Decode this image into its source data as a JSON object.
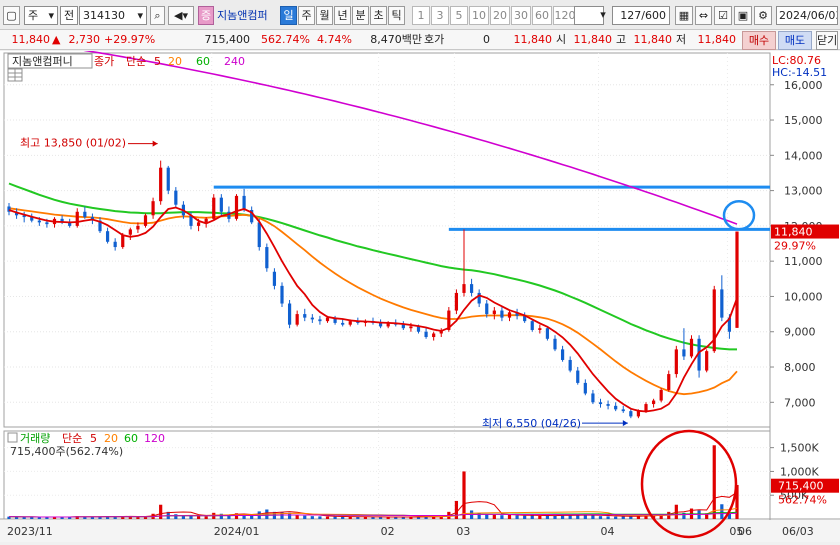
{
  "toolbar": {
    "menu_icon": "window-icon",
    "period_select": "주",
    "market_select": "전",
    "stock_code": "314130",
    "sound_icon": "speaker-icon",
    "badge_label": "증",
    "stock_name": "지놈앤컴퍼",
    "period_buttons": [
      "일",
      "주",
      "월",
      "년",
      "분",
      "초",
      "틱"
    ],
    "selected_period": "일",
    "interval_buttons": [
      "1",
      "3",
      "5",
      "10",
      "20",
      "30",
      "60",
      "120"
    ],
    "count": "127",
    "count_max": "/600",
    "date": "2024/06/03"
  },
  "infobar": {
    "price": "11,840",
    "arrow": "▲",
    "change": "2,730",
    "change_pct": "+29.97%",
    "volume": "715,400",
    "volume_pct": "562.74%",
    "turnover_pct": "4.74%",
    "amount": "8,470백만",
    "quote_label": "호가",
    "quote_value": "0",
    "quote_price": "11,840",
    "open_label": "시",
    "open_value": "11,840",
    "high_label": "고",
    "high_value": "11,840",
    "low_label": "저",
    "low_value": "11,840",
    "buy_label": "매수",
    "sell_label": "매도",
    "close_label": "닫기"
  },
  "chart_data": {
    "type": "candlestick",
    "legend": {
      "name": "지놈앤컴퍼니",
      "items": [
        {
          "label": "종가",
          "color": "#d00000"
        },
        {
          "label": "단순",
          "color": "#d00000"
        },
        {
          "label": "5",
          "color": "#d00000"
        },
        {
          "label": "20",
          "color": "#ff8000"
        },
        {
          "label": "60",
          "color": "#00b000"
        },
        {
          "label": "240",
          "color": "#cc00cc"
        }
      ],
      "lc": "LC:80.76",
      "hc": "HC:-14.51"
    },
    "y_ticks": [
      7000,
      8000,
      9000,
      10000,
      11000,
      12000,
      13000,
      14000,
      15000,
      16000
    ],
    "y_tick_labels": [
      "7,000",
      "8,000",
      "9,000",
      "10,000",
      "11,000",
      "12,000",
      "13,000",
      "14,000",
      "15,000",
      "16,000"
    ],
    "ylim": [
      6300,
      16900
    ],
    "current_price": 11840,
    "current_price_label": "11,840",
    "current_pct_label": "29.97%",
    "hlines": [
      13100,
      11900
    ],
    "max_annotation": "최고 13,850 (01/02)",
    "min_annotation": "최저 6,550 (04/26)",
    "x_tick_labels": [
      "2023/11",
      "2024/01",
      "02",
      "03",
      "04",
      "05",
      "06",
      "06/03"
    ],
    "candles": [
      [
        12550,
        12650,
        12300,
        12400
      ],
      [
        12400,
        12500,
        12200,
        12300
      ],
      [
        12300,
        12400,
        12100,
        12250
      ],
      [
        12250,
        12350,
        12100,
        12150
      ],
      [
        12150,
        12250,
        12000,
        12100
      ],
      [
        12100,
        12200,
        11950,
        12050
      ],
      [
        12050,
        12250,
        11950,
        12200
      ],
      [
        12200,
        12300,
        12050,
        12100
      ],
      [
        12100,
        12200,
        11950,
        12000
      ],
      [
        12000,
        12500,
        11950,
        12400
      ],
      [
        12400,
        12550,
        12200,
        12250
      ],
      [
        12250,
        12350,
        12050,
        12150
      ],
      [
        12150,
        12250,
        11800,
        11850
      ],
      [
        11850,
        11950,
        11500,
        11550
      ],
      [
        11550,
        11650,
        11300,
        11400
      ],
      [
        11400,
        11800,
        11350,
        11750
      ],
      [
        11750,
        11950,
        11600,
        11900
      ],
      [
        11900,
        12100,
        11800,
        12000
      ],
      [
        12000,
        12350,
        11950,
        12300
      ],
      [
        12300,
        12800,
        12200,
        12700
      ],
      [
        12700,
        13850,
        12600,
        13650
      ],
      [
        13650,
        13700,
        12900,
        13000
      ],
      [
        13000,
        13100,
        12500,
        12600
      ],
      [
        12600,
        12700,
        12200,
        12300
      ],
      [
        12300,
        12400,
        11900,
        12000
      ],
      [
        12000,
        12200,
        11850,
        12100
      ],
      [
        12100,
        12250,
        11950,
        12200
      ],
      [
        12200,
        12900,
        12150,
        12800
      ],
      [
        12800,
        12900,
        12300,
        12400
      ],
      [
        12400,
        12550,
        12100,
        12200
      ],
      [
        12200,
        12900,
        12150,
        12850
      ],
      [
        12850,
        13050,
        12400,
        12450
      ],
      [
        12450,
        12550,
        12050,
        12100
      ],
      [
        12100,
        12200,
        11300,
        11400
      ],
      [
        11400,
        11500,
        10700,
        10800
      ],
      [
        10700,
        10800,
        10200,
        10300
      ],
      [
        10300,
        10400,
        9700,
        9800
      ],
      [
        9800,
        9900,
        9100,
        9200
      ],
      [
        9200,
        9600,
        9150,
        9500
      ],
      [
        9500,
        9650,
        9300,
        9400
      ],
      [
        9400,
        9500,
        9250,
        9350
      ],
      [
        9350,
        9450,
        9200,
        9300
      ],
      [
        9300,
        9450,
        9250,
        9400
      ],
      [
        9400,
        9450,
        9200,
        9250
      ],
      [
        9250,
        9350,
        9150,
        9200
      ],
      [
        9200,
        9350,
        9150,
        9300
      ],
      [
        9300,
        9400,
        9200,
        9250
      ],
      [
        9250,
        9350,
        9150,
        9300
      ],
      [
        9300,
        9400,
        9200,
        9250
      ],
      [
        9250,
        9350,
        9100,
        9150
      ],
      [
        9150,
        9300,
        9100,
        9250
      ],
      [
        9250,
        9350,
        9150,
        9200
      ],
      [
        9200,
        9300,
        9050,
        9100
      ],
      [
        9100,
        9250,
        9000,
        9150
      ],
      [
        9150,
        9200,
        8950,
        9000
      ],
      [
        9000,
        9100,
        8800,
        8850
      ],
      [
        8850,
        9000,
        8750,
        8950
      ],
      [
        8950,
        9100,
        8850,
        9050
      ],
      [
        9050,
        9700,
        9000,
        9600
      ],
      [
        9600,
        10200,
        9500,
        10100
      ],
      [
        10100,
        11900,
        10000,
        10350
      ],
      [
        10350,
        10500,
        10000,
        10100
      ],
      [
        10100,
        10200,
        9700,
        9800
      ],
      [
        9800,
        9900,
        9400,
        9500
      ],
      [
        9500,
        9700,
        9350,
        9600
      ],
      [
        9600,
        9700,
        9300,
        9400
      ],
      [
        9400,
        9600,
        9300,
        9550
      ],
      [
        9550,
        9650,
        9350,
        9450
      ],
      [
        9450,
        9550,
        9250,
        9300
      ],
      [
        9300,
        9350,
        9000,
        9050
      ],
      [
        9050,
        9200,
        8950,
        9100
      ],
      [
        9100,
        9150,
        8750,
        8800
      ],
      [
        8800,
        8900,
        8450,
        8500
      ],
      [
        8500,
        8600,
        8150,
        8200
      ],
      [
        8200,
        8300,
        7850,
        7900
      ],
      [
        7900,
        8000,
        7500,
        7550
      ],
      [
        7550,
        7650,
        7200,
        7250
      ],
      [
        7250,
        7350,
        6950,
        7000
      ],
      [
        7000,
        7100,
        6850,
        6950
      ],
      [
        6950,
        7050,
        6800,
        6900
      ],
      [
        6900,
        7000,
        6750,
        6800
      ],
      [
        6800,
        6900,
        6700,
        6750
      ],
      [
        6750,
        6800,
        6550,
        6600
      ],
      [
        6600,
        6800,
        6550,
        6750
      ],
      [
        6750,
        7000,
        6700,
        6950
      ],
      [
        6950,
        7100,
        6850,
        7050
      ],
      [
        7050,
        7400,
        7000,
        7350
      ],
      [
        7350,
        7900,
        7300,
        7800
      ],
      [
        7800,
        8600,
        7700,
        8500
      ],
      [
        8500,
        9100,
        8200,
        8300
      ],
      [
        8300,
        8900,
        8250,
        8800
      ],
      [
        8800,
        8900,
        7700,
        7900
      ],
      [
        7900,
        8500,
        7850,
        8450
      ],
      [
        8450,
        10300,
        8400,
        10200
      ],
      [
        10200,
        10600,
        9300,
        9400
      ],
      [
        9400,
        9500,
        8800,
        9000
      ],
      [
        9110,
        11840,
        9110,
        11840
      ]
    ],
    "ma5": [
      12450,
      12380,
      12320,
      12260,
      12200,
      12150,
      12120,
      12110,
      12100,
      12110,
      12150,
      12180,
      12120,
      12020,
      11880,
      11740,
      11690,
      11720,
      11800,
      11980,
      12250,
      12480,
      12520,
      12440,
      12300,
      12140,
      12070,
      12160,
      12280,
      12330,
      12420,
      12480,
      12380,
      12120,
      11780,
      11400,
      11000,
      10640,
      10300,
      10060,
      9760,
      9560,
      9420,
      9380,
      9360,
      9320,
      9300,
      9290,
      9280,
      9260,
      9250,
      9240,
      9220,
      9190,
      9160,
      9120,
      9060,
      9020,
      9110,
      9310,
      9620,
      9880,
      10030,
      9960,
      9830,
      9720,
      9610,
      9540,
      9460,
      9350,
      9240,
      9140,
      9000,
      8840,
      8630,
      8380,
      8090,
      7800,
      7550,
      7310,
      7100,
      6950,
      6820,
      6760,
      6740,
      6770,
      6820,
      6950,
      7250,
      7700,
      8080,
      8420,
      8560,
      8780,
      9150,
      9370,
      9950
    ],
    "ma20": [
      12500,
      12470,
      12440,
      12410,
      12380,
      12350,
      12320,
      12300,
      12280,
      12260,
      12250,
      12240,
      12220,
      12190,
      12150,
      12110,
      12080,
      12070,
      12070,
      12090,
      12150,
      12210,
      12250,
      12270,
      12260,
      12240,
      12230,
      12250,
      12270,
      12280,
      12300,
      12310,
      12290,
      12220,
      12120,
      11990,
      11830,
      11660,
      11480,
      11310,
      11130,
      10960,
      10800,
      10650,
      10510,
      10380,
      10260,
      10150,
      10040,
      9940,
      9850,
      9770,
      9690,
      9620,
      9560,
      9500,
      9440,
      9390,
      9360,
      9360,
      9390,
      9430,
      9450,
      9460,
      9460,
      9460,
      9470,
      9470,
      9460,
      9440,
      9410,
      9370,
      9300,
      9210,
      9100,
      8970,
      8820,
      8660,
      8500,
      8330,
      8160,
      8000,
      7860,
      7730,
      7610,
      7500,
      7400,
      7320,
      7260,
      7230,
      7250,
      7290,
      7340,
      7420,
      7540,
      7640,
      7880
    ],
    "ma60": [
      13200,
      13120,
      13040,
      12960,
      12880,
      12810,
      12740,
      12680,
      12630,
      12590,
      12550,
      12510,
      12480,
      12450,
      12420,
      12400,
      12380,
      12370,
      12360,
      12360,
      12360,
      12370,
      12380,
      12390,
      12390,
      12390,
      12380,
      12370,
      12360,
      12350,
      12340,
      12320,
      12290,
      12250,
      12200,
      12140,
      12080,
      12010,
      11940,
      11870,
      11800,
      11730,
      11670,
      11600,
      11540,
      11480,
      11420,
      11370,
      11310,
      11260,
      11210,
      11160,
      11110,
      11060,
      11010,
      10960,
      10910,
      10860,
      10820,
      10790,
      10760,
      10740,
      10710,
      10670,
      10630,
      10580,
      10530,
      10480,
      10430,
      10370,
      10310,
      10240,
      10170,
      10090,
      10000,
      9910,
      9820,
      9720,
      9620,
      9520,
      9420,
      9320,
      9220,
      9130,
      9040,
      8960,
      8880,
      8810,
      8750,
      8690,
      8640,
      8600,
      8570,
      8540,
      8520,
      8500,
      8500
    ],
    "ma240_range": [
      17300,
      12050
    ],
    "volume": {
      "label": "거래량",
      "legend": [
        {
          "label": "단순",
          "color": "#d00000"
        },
        {
          "label": "5",
          "color": "#d00000"
        },
        {
          "label": "20",
          "color": "#ff8000"
        },
        {
          "label": "60",
          "color": "#00b000"
        },
        {
          "label": "120",
          "color": "#cc00cc"
        }
      ],
      "info": "715,400주(562.74%)",
      "y_ticks": [
        500000,
        1000000,
        1500000
      ],
      "y_tick_labels": [
        "500K",
        "1,000K",
        "1,500K"
      ],
      "ylim": [
        0,
        1850000
      ],
      "current_label": "715,400",
      "current_pct_label": "562.74%",
      "values": [
        50000,
        45000,
        40000,
        42000,
        38000,
        40000,
        45000,
        42000,
        40000,
        60000,
        45000,
        40000,
        55000,
        60000,
        50000,
        55000,
        50000,
        48000,
        60000,
        110000,
        300000,
        150000,
        100000,
        80000,
        70000,
        60000,
        55000,
        130000,
        110000,
        80000,
        120000,
        90000,
        75000,
        160000,
        200000,
        150000,
        140000,
        130000,
        90000,
        70000,
        60000,
        55000,
        50000,
        50000,
        45000,
        48000,
        45000,
        42000,
        40000,
        45000,
        40000,
        42000,
        40000,
        40000,
        45000,
        50000,
        48000,
        55000,
        150000,
        380000,
        1000000,
        180000,
        120000,
        100000,
        90000,
        80000,
        85000,
        75000,
        70000,
        80000,
        65000,
        75000,
        70000,
        85000,
        80000,
        90000,
        85000,
        75000,
        60000,
        55000,
        50000,
        60000,
        55000,
        70000,
        80000,
        80000,
        100000,
        150000,
        300000,
        130000,
        220000,
        180000,
        120000,
        1550000,
        310000,
        120000,
        715400
      ]
    }
  }
}
